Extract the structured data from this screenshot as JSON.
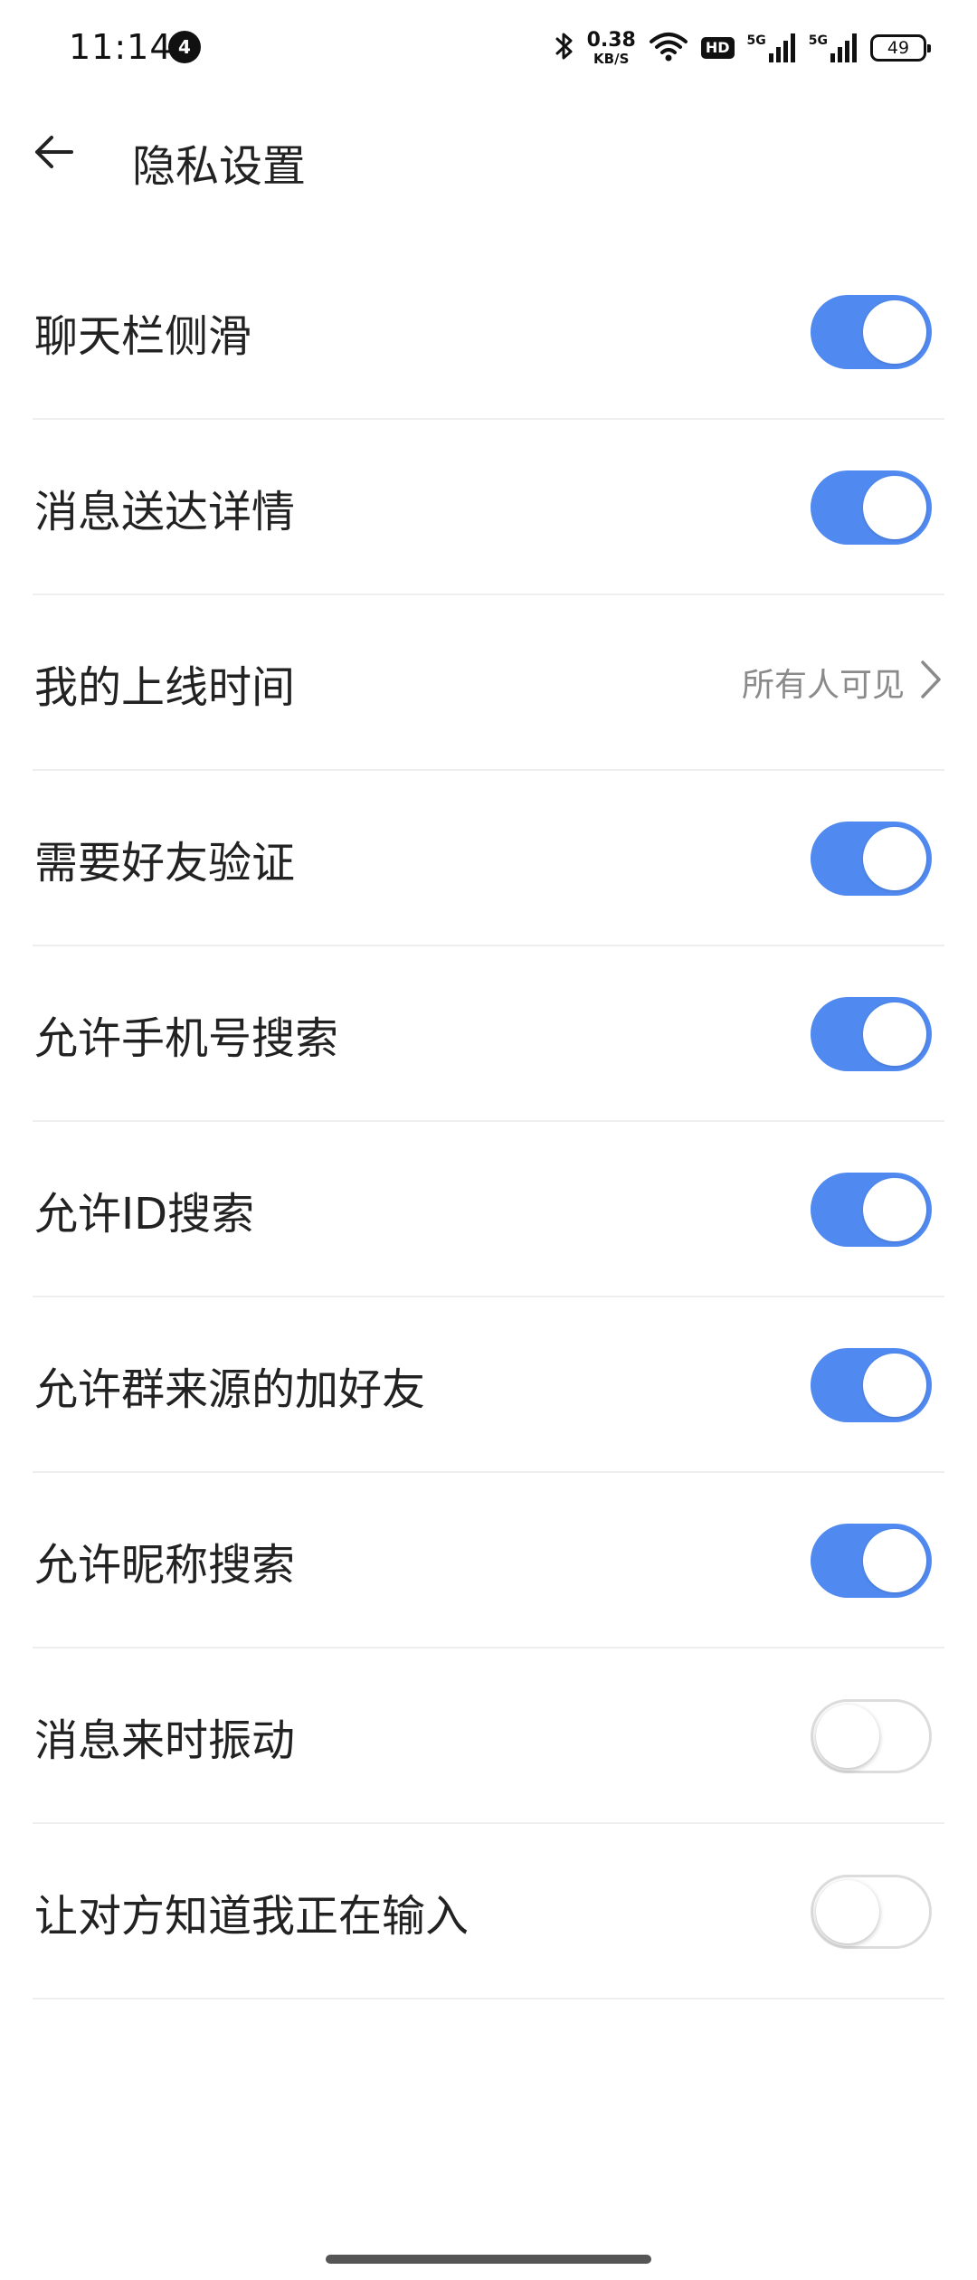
{
  "status_bar": {
    "time": "11:14",
    "notification_count": "4",
    "net_speed_value": "0.38",
    "net_speed_unit": "KB/S",
    "hd_label": "HD",
    "signal1_label": "5G",
    "signal2_label": "5G",
    "battery": "49"
  },
  "header": {
    "title": "隐私设置",
    "back_icon": "arrow-left-icon"
  },
  "settings": [
    {
      "label": "聊天栏侧滑",
      "type": "toggle",
      "on": true
    },
    {
      "label": "消息送达详情",
      "type": "toggle",
      "on": true
    },
    {
      "label": "我的上线时间",
      "type": "link",
      "value": "所有人可见"
    },
    {
      "label": "需要好友验证",
      "type": "toggle",
      "on": true
    },
    {
      "label": "允许手机号搜索",
      "type": "toggle",
      "on": true
    },
    {
      "label": "允许ID搜索",
      "type": "toggle",
      "on": true
    },
    {
      "label": "允许群来源的加好友",
      "type": "toggle",
      "on": true
    },
    {
      "label": "允许昵称搜索",
      "type": "toggle",
      "on": true
    },
    {
      "label": "消息来时振动",
      "type": "toggle",
      "on": false
    },
    {
      "label": "让对方知道我正在输入",
      "type": "toggle",
      "on": false
    }
  ],
  "colors": {
    "toggle_on": "#5089f0",
    "toggle_off_border": "#dcdcdc",
    "divider": "#eeeeee",
    "secondary_text": "#8a8a8a"
  }
}
